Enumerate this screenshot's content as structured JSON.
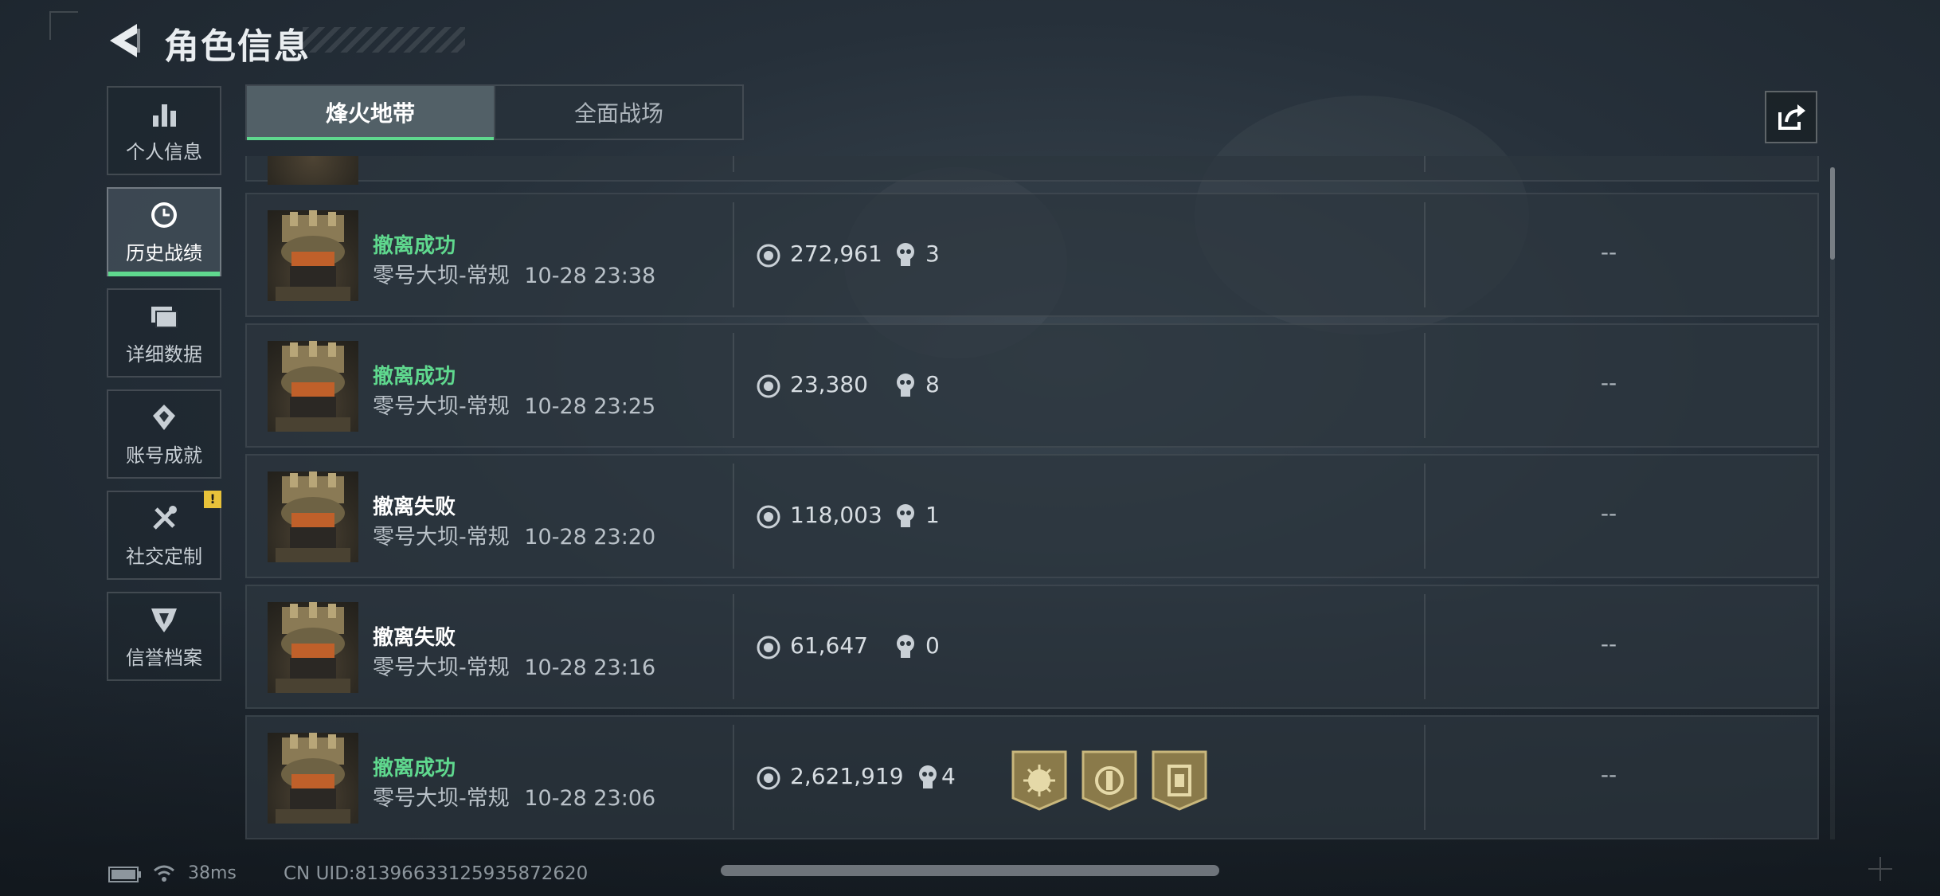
{
  "header": {
    "title": "角色信息"
  },
  "sidebar": {
    "items": [
      {
        "label": "个人信息",
        "icon": "bar-chart-icon"
      },
      {
        "label": "历史战绩",
        "icon": "clock-history-icon",
        "active": true
      },
      {
        "label": "详细数据",
        "icon": "folders-icon"
      },
      {
        "label": "账号成就",
        "icon": "achievement-medal-icon"
      },
      {
        "label": "社交定制",
        "icon": "tools-icon",
        "badge": "!"
      },
      {
        "label": "信誉档案",
        "icon": "credit-shield-icon"
      }
    ]
  },
  "tabs": [
    {
      "label": "烽火地带",
      "active": true
    },
    {
      "label": "全面战场"
    }
  ],
  "records": [
    {
      "status": "撤离成功",
      "result": "success",
      "map": "零号大坝-常规",
      "time": "10-28 23:38",
      "value": "272,961",
      "kills": "3",
      "medals": [],
      "extra": "--"
    },
    {
      "status": "撤离成功",
      "result": "success",
      "map": "零号大坝-常规",
      "time": "10-28 23:25",
      "value": "23,380",
      "kills": "8",
      "medals": [],
      "extra": "--"
    },
    {
      "status": "撤离失败",
      "result": "fail",
      "map": "零号大坝-常规",
      "time": "10-28 23:20",
      "value": "118,003",
      "kills": "1",
      "medals": [],
      "extra": "--"
    },
    {
      "status": "撤离失败",
      "result": "fail",
      "map": "零号大坝-常规",
      "time": "10-28 23:16",
      "value": "61,647",
      "kills": "0",
      "medals": [],
      "extra": "--"
    },
    {
      "status": "撤离成功",
      "result": "success",
      "map": "零号大坝-常规",
      "time": "10-28 23:06",
      "value": "2,621,919",
      "kills": "4",
      "medals": [
        "sun-medal-icon",
        "emblem-medal-icon",
        "card-medal-icon"
      ],
      "extra": "--"
    }
  ],
  "footer": {
    "ping": "38ms",
    "uid": "CN UID:8139663312593587262​0"
  },
  "colors": {
    "success": "#5fd88e",
    "accent": "#5fd88e",
    "warning": "#e8c23a",
    "medal": "#8a7a4a"
  }
}
